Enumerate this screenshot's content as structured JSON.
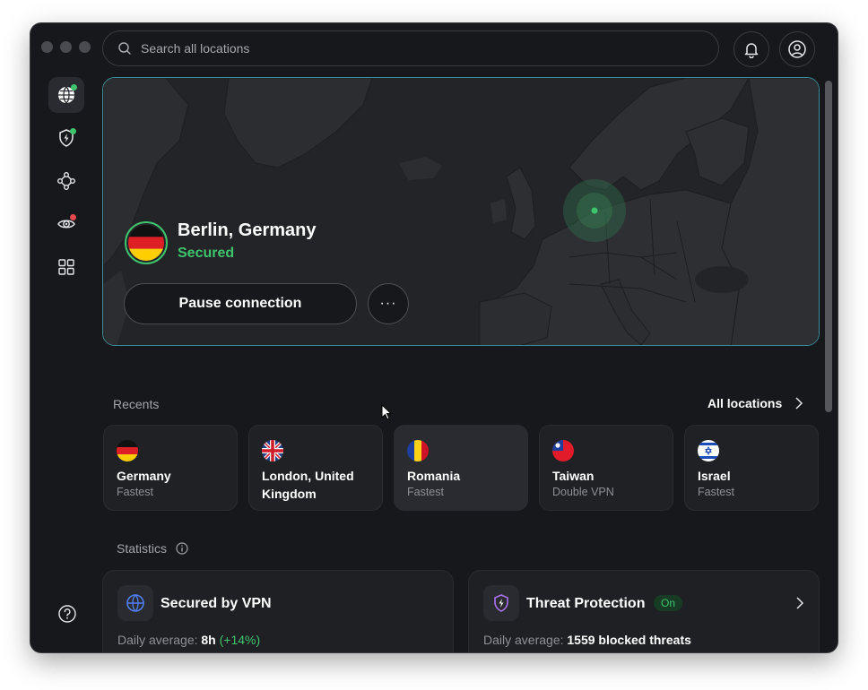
{
  "search": {
    "placeholder": "Search all locations"
  },
  "connection": {
    "city": "Berlin, Germany",
    "status": "Secured",
    "pause_label": "Pause connection",
    "more_label": "···"
  },
  "recents": {
    "label": "Recents",
    "all_locations_label": "All locations",
    "items": [
      {
        "name": "Germany",
        "sub": "Fastest",
        "flag": "germany"
      },
      {
        "name": "London, United Kingdom",
        "sub": "",
        "flag": "united-kingdom"
      },
      {
        "name": "Romania",
        "sub": "Fastest",
        "flag": "romania"
      },
      {
        "name": "Taiwan",
        "sub": "Double VPN",
        "flag": "taiwan"
      },
      {
        "name": "Israel",
        "sub": "Fastest",
        "flag": "israel"
      }
    ]
  },
  "statistics": {
    "label": "Statistics",
    "vpn": {
      "title": "Secured by VPN",
      "avg_label": "Daily average:",
      "avg_value": "8h",
      "avg_change": "(+14%)"
    },
    "threat": {
      "title": "Threat Protection",
      "badge": "On",
      "avg_label": "Daily average:",
      "avg_value": "1559 blocked threats"
    }
  },
  "colors": {
    "accent_green": "#3fc46d",
    "hero_border": "#3b8e93",
    "background": "#17181b",
    "alert_red": "#e5484d"
  }
}
